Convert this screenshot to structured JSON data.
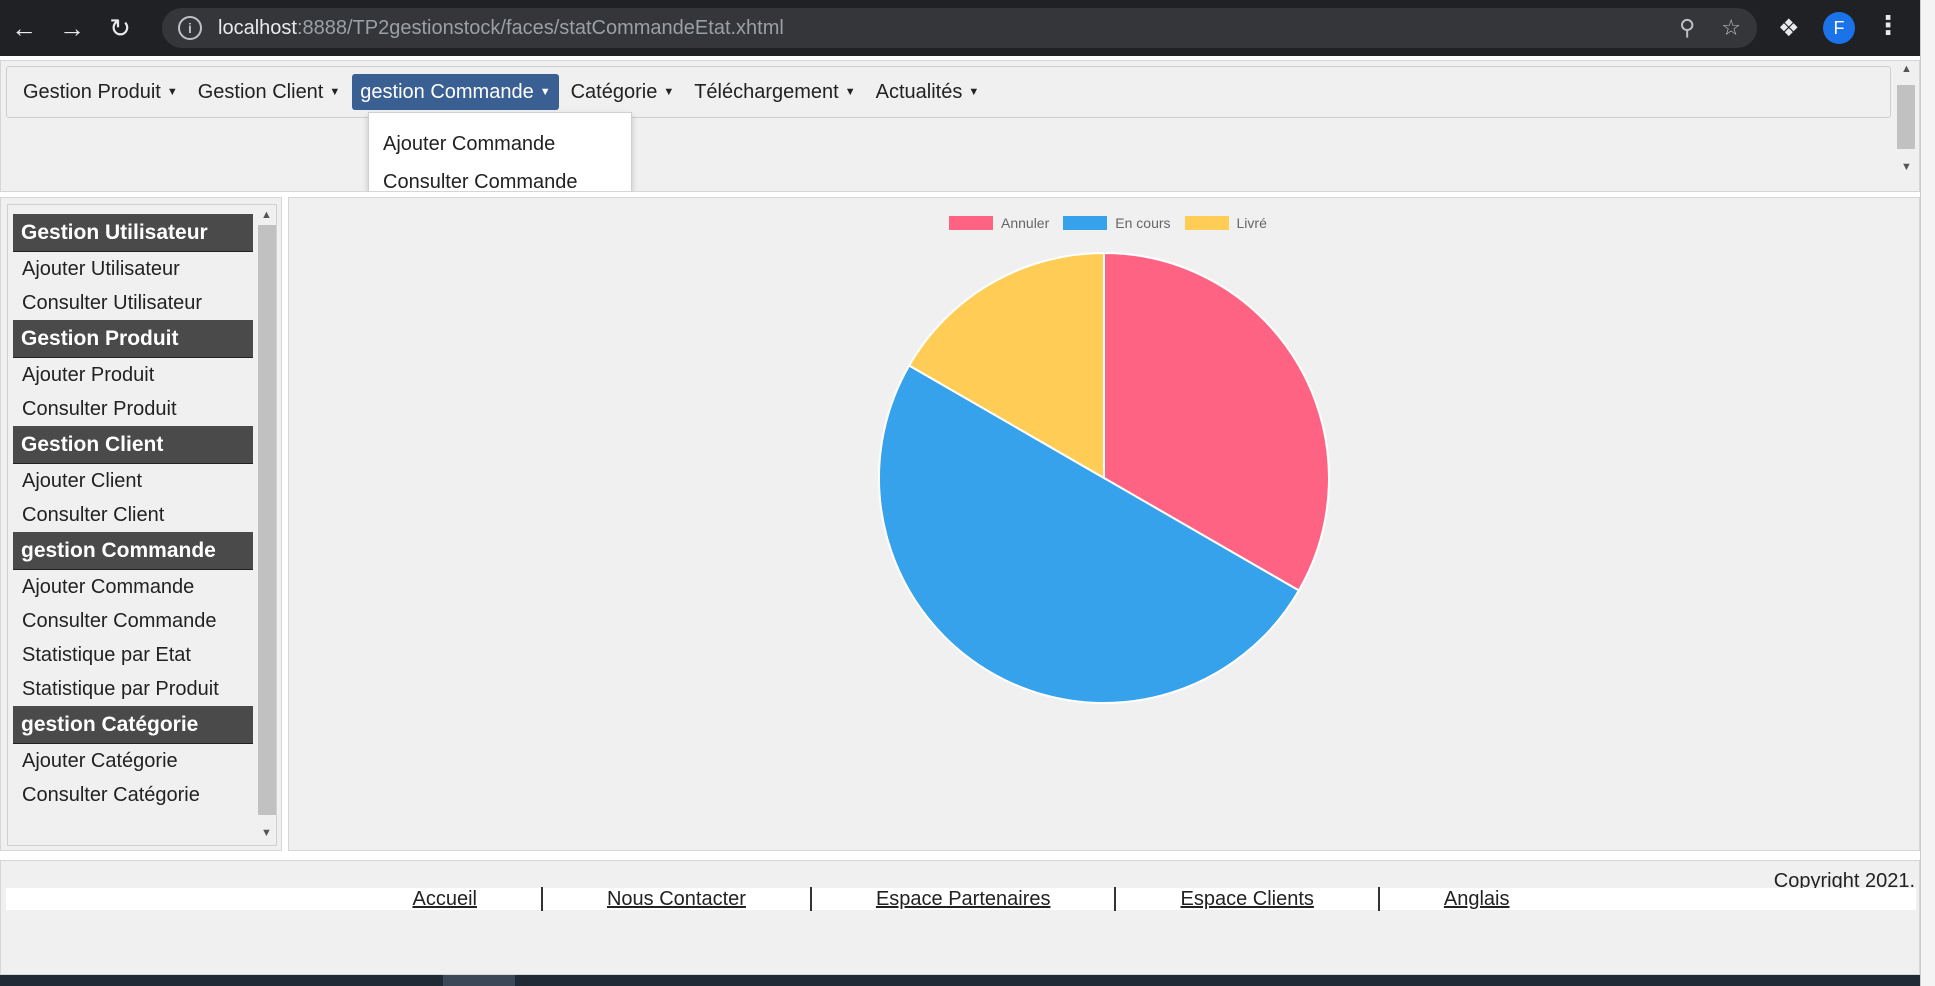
{
  "browser": {
    "url_host": "localhost",
    "url_rest": ":8888/TP2gestionstock/faces/statCommandeEtat.xhtml",
    "profile_initial": "F"
  },
  "menubar": {
    "items": [
      {
        "label": "Gestion Produit"
      },
      {
        "label": "Gestion Client"
      },
      {
        "label": "gestion Commande"
      },
      {
        "label": "Catégorie"
      },
      {
        "label": "Téléchargement"
      },
      {
        "label": "Actualités"
      }
    ],
    "dropdown": [
      "Ajouter Commande",
      "Consulter Commande"
    ]
  },
  "sidebar": {
    "sections": [
      {
        "title": "Gestion Utilisateur",
        "links": [
          "Ajouter Utilisateur",
          "Consulter Utilisateur"
        ]
      },
      {
        "title": "Gestion Produit",
        "links": [
          "Ajouter Produit",
          "Consulter Produit"
        ]
      },
      {
        "title": "Gestion Client",
        "links": [
          "Ajouter Client",
          "Consulter Client"
        ]
      },
      {
        "title": "gestion Commande",
        "links": [
          "Ajouter Commande",
          "Consulter Commande",
          "Statistique par Etat",
          "Statistique par Produit"
        ]
      },
      {
        "title": "gestion Catégorie",
        "links": [
          "Ajouter Catégorie",
          "Consulter Catégorie"
        ]
      }
    ]
  },
  "chart_data": {
    "type": "pie",
    "categories": [
      "Annuler",
      "En cours",
      "Livré"
    ],
    "values": [
      1,
      1.5,
      0.5
    ],
    "colors": [
      "#ff6384",
      "#36a2eb",
      "#ffcd56"
    ],
    "legend_position": "top"
  },
  "footer": {
    "copyright": "Copyright 2021.",
    "links": [
      "Accueil",
      "Nous Contacter",
      "Espace Partenaires",
      "Espace Clients",
      "Anglais"
    ]
  }
}
